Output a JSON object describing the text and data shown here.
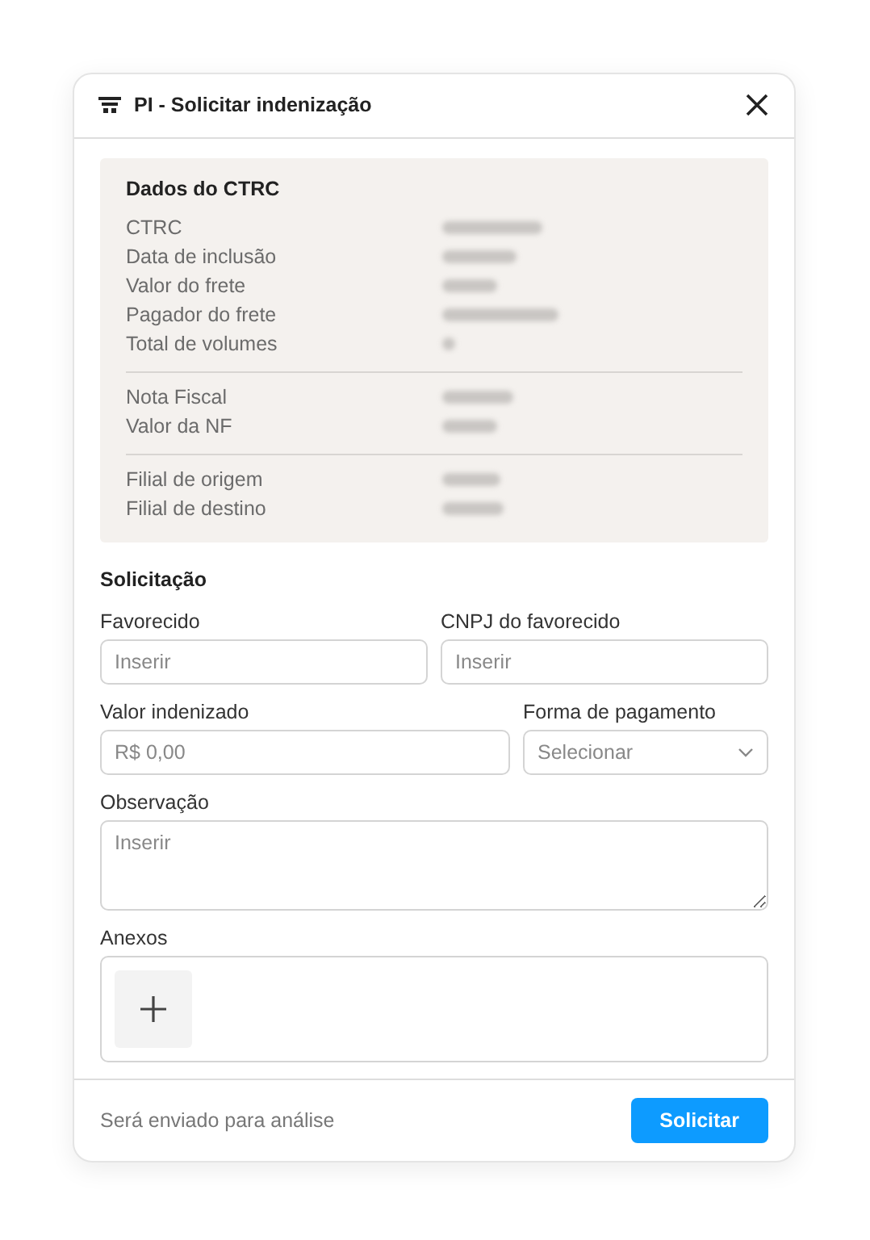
{
  "dialog": {
    "title": "PI - Solicitar indenização"
  },
  "ctrc": {
    "title": "Dados do CTRC",
    "groups": [
      [
        {
          "label": "CTRC",
          "blurred": true
        },
        {
          "label": "Data de inclusão",
          "blurred": true
        },
        {
          "label": "Valor do frete",
          "blurred": true
        },
        {
          "label": "Pagador do frete",
          "blurred": true
        },
        {
          "label": "Total de volumes",
          "blurred": true
        }
      ],
      [
        {
          "label": "Nota Fiscal",
          "blurred": true
        },
        {
          "label": "Valor da NF",
          "blurred": true
        }
      ],
      [
        {
          "label": "Filial de origem",
          "blurred": true
        },
        {
          "label": "Filial de destino",
          "blurred": true
        }
      ]
    ]
  },
  "form": {
    "title": "Solicitação",
    "rows": [
      [
        {
          "kind": "input",
          "label": "Favorecido",
          "placeholder": "Inserir"
        },
        {
          "kind": "input",
          "label": "CNPJ do favorecido",
          "placeholder": "Inserir"
        }
      ],
      [
        {
          "kind": "input",
          "label": "Valor indenizado",
          "placeholder": "R$ 0,00"
        },
        {
          "kind": "select",
          "label": "Forma de pagamento",
          "placeholder": "Selecionar"
        }
      ],
      [
        {
          "kind": "textarea",
          "label": "Observação",
          "placeholder": "Inserir"
        }
      ],
      [
        {
          "kind": "attachments",
          "label": "Anexos"
        }
      ]
    ]
  },
  "footer": {
    "note": "Será enviado para análise",
    "button": "Solicitar"
  }
}
